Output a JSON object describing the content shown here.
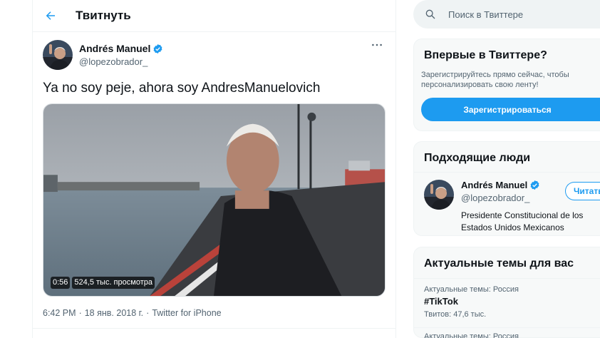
{
  "header": {
    "title": "Твитнуть"
  },
  "tweet": {
    "author_name": "Andrés Manuel",
    "author_handle": "@lopezobrador_",
    "text": "Ya no soy peje, ahora soy AndresManuelovich",
    "video": {
      "duration": "0:56",
      "views": "524,5 тыс. просмотра"
    },
    "time": "6:42 PM",
    "date": "18 янв. 2018 г.",
    "source": "Twitter for iPhone",
    "dot": "·",
    "more_icon": "more-horizontal-icon"
  },
  "search": {
    "placeholder": "Поиск в Твиттере"
  },
  "signup_card": {
    "title": "Впервые в Твиттере?",
    "text": "Зарегистрируйтесь прямо сейчас, чтобы персонализировать свою ленту!",
    "button": "Зарегистрироваться"
  },
  "who_to_follow": {
    "title": "Подходящие люди",
    "user": {
      "name": "Andrés Manuel",
      "handle": "@lopezobrador_",
      "bio": "Presidente Constitucional de los Estados Unidos Mexicanos",
      "follow_label": "Читать"
    }
  },
  "trends": {
    "title": "Актуальные темы для вас",
    "items": [
      {
        "context": "Актуальные темы: Россия",
        "name": "#TikTok",
        "count": "Твитов: 47,6 тыс."
      },
      {
        "context": "Актуальные темы: Россия"
      }
    ]
  },
  "colors": {
    "accent": "#1d9bf0",
    "text": "#0f1419",
    "secondary": "#536471",
    "card_bg": "#f7f9f9"
  }
}
